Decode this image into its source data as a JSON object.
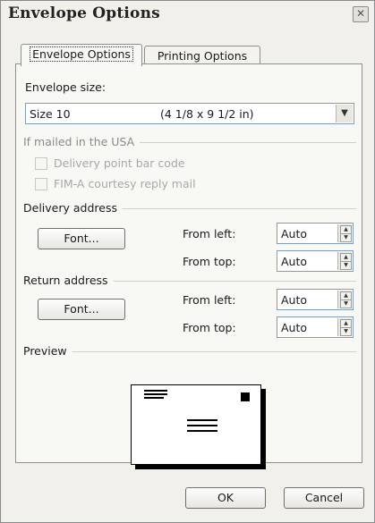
{
  "window": {
    "title": "Envelope Options",
    "close_icon": "close-icon"
  },
  "tabs": [
    {
      "label": "Envelope Options",
      "active": true
    },
    {
      "label": "Printing Options",
      "active": false
    }
  ],
  "envelope_size": {
    "label": "Envelope size:",
    "selected_name": "Size 10",
    "selected_dimensions": "(4 1/8 x 9 1/2 in)"
  },
  "usa_section": {
    "heading": "If mailed in the USA",
    "options": [
      {
        "label": "Delivery point bar code",
        "checked": false,
        "enabled": false
      },
      {
        "label": "FIM-A courtesy reply mail",
        "checked": false,
        "enabled": false
      }
    ]
  },
  "delivery_address": {
    "heading": "Delivery address",
    "font_button": "Font...",
    "from_left_label": "From left:",
    "from_left_value": "Auto",
    "from_top_label": "From top:",
    "from_top_value": "Auto"
  },
  "return_address": {
    "heading": "Return address",
    "font_button": "Font...",
    "from_left_label": "From left:",
    "from_left_value": "Auto",
    "from_top_label": "From top:",
    "from_top_value": "Auto"
  },
  "preview": {
    "heading": "Preview"
  },
  "buttons": {
    "ok": "OK",
    "cancel": "Cancel"
  }
}
